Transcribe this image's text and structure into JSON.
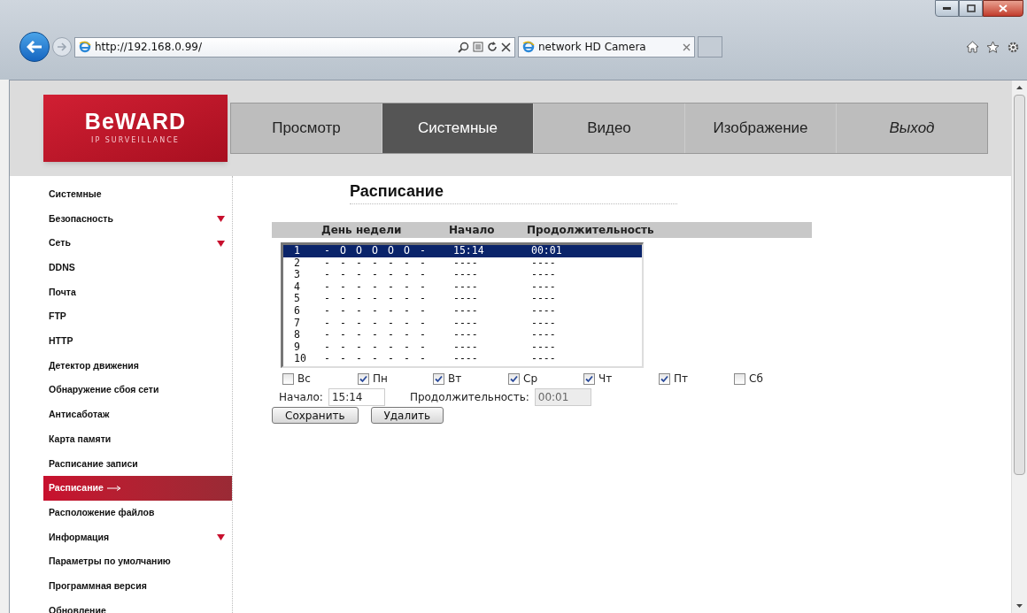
{
  "browser": {
    "url": "http://192.168.0.99/",
    "tab_title": "network HD Camera"
  },
  "logo": {
    "brand": "BeWARD",
    "tagline": "IP SURVEILLANCE"
  },
  "nav": [
    {
      "label": "Просмотр",
      "selected": false
    },
    {
      "label": "Системные",
      "selected": true
    },
    {
      "label": "Видео",
      "selected": false
    },
    {
      "label": "Изображение",
      "selected": false
    },
    {
      "label": "Выход",
      "selected": false
    }
  ],
  "sidebar": {
    "items": [
      {
        "label": "Системные",
        "selected": false,
        "expandable": false
      },
      {
        "label": "Безопасность",
        "selected": false,
        "expandable": true
      },
      {
        "label": "Сеть",
        "selected": false,
        "expandable": true
      },
      {
        "label": "DDNS",
        "selected": false,
        "expandable": false
      },
      {
        "label": "Почта",
        "selected": false,
        "expandable": false
      },
      {
        "label": "FTP",
        "selected": false,
        "expandable": false
      },
      {
        "label": "HTTP",
        "selected": false,
        "expandable": false
      },
      {
        "label": "Детектор движения",
        "selected": false,
        "expandable": false
      },
      {
        "label": "Обнаружение сбоя сети",
        "selected": false,
        "expandable": false
      },
      {
        "label": "Антисаботаж",
        "selected": false,
        "expandable": false
      },
      {
        "label": "Карта памяти",
        "selected": false,
        "expandable": false
      },
      {
        "label": "Расписание записи",
        "selected": false,
        "expandable": false
      },
      {
        "label": "Расписание",
        "selected": true,
        "expandable": false
      },
      {
        "label": "Расположение файлов",
        "selected": false,
        "expandable": false
      },
      {
        "label": "Информация",
        "selected": false,
        "expandable": true
      },
      {
        "label": "Параметры по умолчанию",
        "selected": false,
        "expandable": false
      },
      {
        "label": "Программная версия",
        "selected": false,
        "expandable": false
      },
      {
        "label": "Обновление",
        "selected": false,
        "expandable": false
      }
    ]
  },
  "page_title": "Расписание",
  "schedule": {
    "columns": [
      "День недели",
      "Начало",
      "Продолжительность"
    ],
    "rows": [
      {
        "number": "1",
        "days": [
          "-",
          "O",
          "O",
          "O",
          "O",
          "O",
          "-"
        ],
        "start": "15:14",
        "duration": "00:01",
        "selected": true
      },
      {
        "number": "2",
        "days": [
          "-",
          "-",
          "-",
          "-",
          "-",
          "-",
          "-"
        ],
        "start": "----",
        "duration": "----",
        "selected": false
      },
      {
        "number": "3",
        "days": [
          "-",
          "-",
          "-",
          "-",
          "-",
          "-",
          "-"
        ],
        "start": "----",
        "duration": "----",
        "selected": false
      },
      {
        "number": "4",
        "days": [
          "-",
          "-",
          "-",
          "-",
          "-",
          "-",
          "-"
        ],
        "start": "----",
        "duration": "----",
        "selected": false
      },
      {
        "number": "5",
        "days": [
          "-",
          "-",
          "-",
          "-",
          "-",
          "-",
          "-"
        ],
        "start": "----",
        "duration": "----",
        "selected": false
      },
      {
        "number": "6",
        "days": [
          "-",
          "-",
          "-",
          "-",
          "-",
          "-",
          "-"
        ],
        "start": "----",
        "duration": "----",
        "selected": false
      },
      {
        "number": "7",
        "days": [
          "-",
          "-",
          "-",
          "-",
          "-",
          "-",
          "-"
        ],
        "start": "----",
        "duration": "----",
        "selected": false
      },
      {
        "number": "8",
        "days": [
          "-",
          "-",
          "-",
          "-",
          "-",
          "-",
          "-"
        ],
        "start": "----",
        "duration": "----",
        "selected": false
      },
      {
        "number": "9",
        "days": [
          "-",
          "-",
          "-",
          "-",
          "-",
          "-",
          "-"
        ],
        "start": "----",
        "duration": "----",
        "selected": false
      },
      {
        "number": "10",
        "days": [
          "-",
          "-",
          "-",
          "-",
          "-",
          "-",
          "-"
        ],
        "start": "----",
        "duration": "----",
        "selected": false
      }
    ]
  },
  "weekdays": [
    {
      "label": "Вс",
      "checked": false
    },
    {
      "label": "Пн",
      "checked": true
    },
    {
      "label": "Вт",
      "checked": true
    },
    {
      "label": "Ср",
      "checked": true
    },
    {
      "label": "Чт",
      "checked": true
    },
    {
      "label": "Пт",
      "checked": true
    },
    {
      "label": "Сб",
      "checked": false
    }
  ],
  "start_field": {
    "label": "Начало:",
    "value": "15:14"
  },
  "duration_field": {
    "label": "Продолжительность:",
    "value": "00:01",
    "disabled": true
  },
  "buttons": [
    "Сохранить",
    "Удалить"
  ]
}
